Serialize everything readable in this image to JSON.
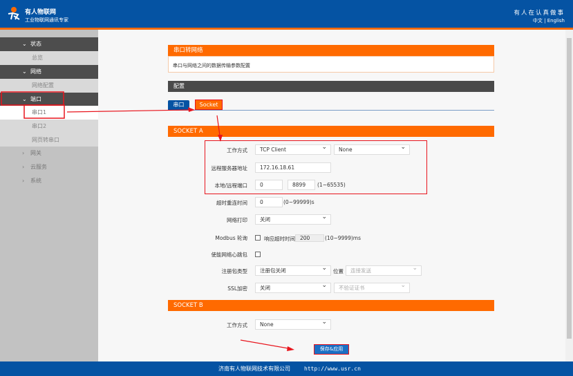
{
  "header": {
    "brand": "有人物联网",
    "subtitle": "工业物联网通讯专家",
    "slogan": "有人在认真做事",
    "lang_cn": "中文",
    "lang_sep": "|",
    "lang_en": "English"
  },
  "sidebar": {
    "items": [
      {
        "label": "状态",
        "type": "group",
        "expanded": true
      },
      {
        "label": "总览",
        "type": "sub"
      },
      {
        "label": "网络",
        "type": "group",
        "expanded": true
      },
      {
        "label": "网络配置",
        "type": "sub"
      },
      {
        "label": "端口",
        "type": "group",
        "expanded": true
      },
      {
        "label": "串口1",
        "type": "sub",
        "active": true
      },
      {
        "label": "串口2",
        "type": "sub"
      },
      {
        "label": "网页转串口",
        "type": "sub"
      },
      {
        "label": "网关",
        "type": "group",
        "expanded": false
      },
      {
        "label": "云服务",
        "type": "group",
        "expanded": false
      },
      {
        "label": "系统",
        "type": "group",
        "expanded": false
      }
    ]
  },
  "main": {
    "section_title": "串口转网络",
    "section_desc": "串口与网络之间的数据传输参数配置",
    "config_title": "配置",
    "tabs": [
      {
        "label": "串口",
        "active": false
      },
      {
        "label": "Socket",
        "active": true
      }
    ],
    "socket_a": {
      "title": "SOCKET A",
      "work_mode_label": "工作方式",
      "work_mode": "TCP Client",
      "work_mode2": "None",
      "server_label": "远程服务器地址",
      "server": "172.16.18.61",
      "port_label": "本地/远程端口",
      "local_port": "0",
      "remote_port": "8899",
      "port_hint": "(1~65535)",
      "reconnect_label": "超时重连时间",
      "reconnect": "0",
      "reconnect_hint": "(0~99999)s",
      "print_label": "网络打印",
      "print": "关闭",
      "modbus_label": "Modbus 轮询",
      "modbus_resp_label": "响应超时时间",
      "modbus_resp": "200",
      "modbus_hint": "(10~9999)ms",
      "heartbeat_label": "使能网络心跳包",
      "reg_label": "注册包类型",
      "reg": "注册包关闭",
      "pos_label": "位置",
      "pos": "连接发送",
      "ssl_label": "SSL加密",
      "ssl": "关闭",
      "cert": "不验证证书"
    },
    "socket_b": {
      "title": "SOCKET B",
      "work_mode_label": "工作方式",
      "work_mode": "None"
    },
    "save_label": "保存&应用"
  },
  "footer": {
    "company": "济南有人物联网技术有限公司",
    "url": "http://www.usr.cn"
  },
  "colors": {
    "header": "#0553a3",
    "accent": "#ff6a00",
    "annotation": "#e8141c"
  }
}
